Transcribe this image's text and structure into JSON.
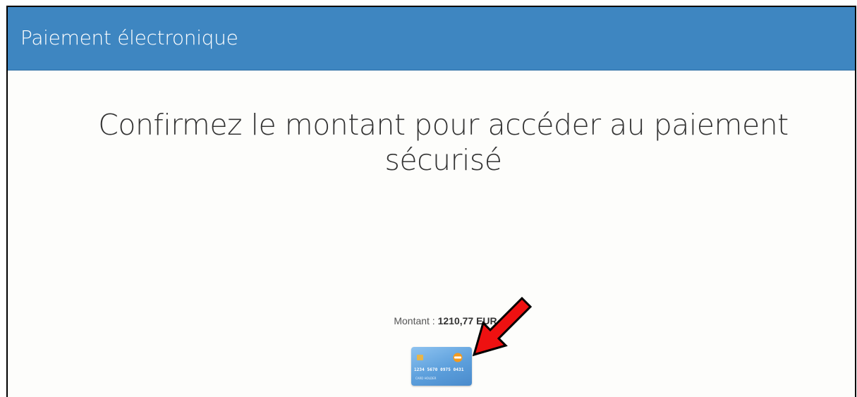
{
  "header": {
    "title": "Paiement électronique"
  },
  "main": {
    "heading_line1": "Confirmez le montant pour accéder au paiement",
    "heading_line2": "sécurisé",
    "amount_label": "Montant :",
    "amount_value": "1210,77 EUR"
  },
  "card": {
    "number": "1234 5670 0975 0431",
    "holder": "CARD HOLDER",
    "icon": "credit-card-icon"
  },
  "annotation": {
    "icon": "red-arrow-icon"
  },
  "colors": {
    "header_bg": "#3e86c1",
    "page_bg": "#fdfdfb",
    "arrow": "#ee1111"
  }
}
